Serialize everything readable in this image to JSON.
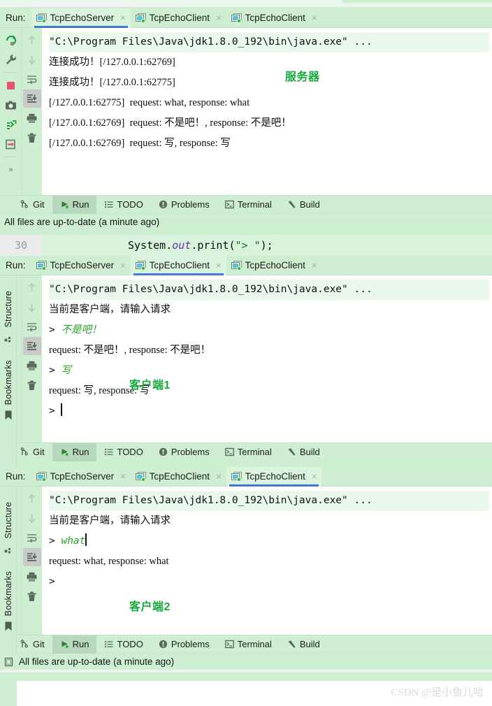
{
  "app": {
    "ide": "IntelliJ IDEA",
    "accent_blue": "#3e7ad1",
    "chrome_green": "#cdeed1",
    "annotation_green": "#15a83a",
    "user_input_green": "#2aa02a"
  },
  "run_label": "Run:",
  "tabs": [
    {
      "label": "TcpEchoServer",
      "close": "×",
      "icon": "run-config-icon"
    },
    {
      "label": "TcpEchoClient",
      "close": "×",
      "icon": "run-config-icon"
    },
    {
      "label": "TcpEchoClient",
      "close": "×",
      "icon": "run-config-icon"
    }
  ],
  "toolbar": {
    "left": [
      {
        "name": "rerun-icon",
        "tooltip": "Rerun"
      },
      {
        "name": "wrench-icon",
        "tooltip": "Edit Configuration"
      },
      {
        "name": "stop-icon",
        "tooltip": "Stop"
      },
      {
        "name": "camera-icon",
        "tooltip": "Dump Threads"
      },
      {
        "name": "threads-icon",
        "tooltip": "Thread Dump"
      },
      {
        "name": "exit-icon",
        "tooltip": "Close Session"
      }
    ],
    "right": [
      {
        "name": "arrow-up-icon",
        "tooltip": "Up the Stack Trace"
      },
      {
        "name": "arrow-down-icon",
        "tooltip": "Down the Stack Trace"
      },
      {
        "name": "soft-wrap-icon",
        "tooltip": "Soft-Wrap"
      },
      {
        "name": "scroll-to-end-icon",
        "tooltip": "Scroll to End",
        "selected": true
      },
      {
        "name": "print-icon",
        "tooltip": "Print"
      },
      {
        "name": "trash-icon",
        "tooltip": "Clear All"
      }
    ],
    "expand": "»"
  },
  "command_line": "\"C:\\Program Files\\Java\\jdk1.8.0_192\\bin\\java.exe\" ...",
  "panels": [
    {
      "id": "server",
      "active_tab_index": 0,
      "annotation": "服务器",
      "lines": [
        {
          "type": "cmd",
          "text": "\"C:\\Program Files\\Java\\jdk1.8.0_192\\bin\\java.exe\" ..."
        },
        {
          "type": "out",
          "text": "连接成功！[/127.0.0.1:62769]"
        },
        {
          "type": "out",
          "text": "连接成功！[/127.0.0.1:62775]"
        },
        {
          "type": "out",
          "text": "[/127.0.0.1:62775]  request: what, response: what"
        },
        {
          "type": "out",
          "text": "[/127.0.0.1:62769]  request: 不是吧！, response: 不是吧！"
        },
        {
          "type": "out",
          "text": "[/127.0.0.1:62769]  request: 写, response: 写"
        }
      ]
    },
    {
      "id": "client1",
      "active_tab_index": 1,
      "annotation": "客户端1",
      "lines": [
        {
          "type": "cmd",
          "text": "\"C:\\Program Files\\Java\\jdk1.8.0_192\\bin\\java.exe\" ..."
        },
        {
          "type": "out",
          "text": "当前是客户端，请输入请求"
        },
        {
          "type": "prompt",
          "prefix": "> ",
          "input": "不是吧！"
        },
        {
          "type": "out",
          "text": "request: 不是吧！, response: 不是吧！"
        },
        {
          "type": "prompt",
          "prefix": "> ",
          "input": "写"
        },
        {
          "type": "out",
          "text": "request: 写, response: 写"
        },
        {
          "type": "prompt",
          "prefix": "> ",
          "input": "",
          "caret": true
        }
      ]
    },
    {
      "id": "client2",
      "active_tab_index": 2,
      "annotation": "客户端2",
      "lines": [
        {
          "type": "cmd",
          "text": "\"C:\\Program Files\\Java\\jdk1.8.0_192\\bin\\java.exe\" ..."
        },
        {
          "type": "out",
          "text": "当前是客户端，请输入请求"
        },
        {
          "type": "prompt",
          "prefix": "> ",
          "input": "what",
          "caret": true
        },
        {
          "type": "out",
          "text": "request: what, response: what"
        },
        {
          "type": "prompt",
          "prefix": "> ",
          "input": ""
        }
      ]
    }
  ],
  "tool_window_bar": {
    "items": [
      {
        "label": "Git",
        "icon": "git-branch-icon"
      },
      {
        "label": "Run",
        "icon": "run-play-icon",
        "active": true
      },
      {
        "label": "TODO",
        "icon": "todo-list-icon"
      },
      {
        "label": "Problems",
        "icon": "problems-warning-icon"
      },
      {
        "label": "Terminal",
        "icon": "terminal-icon"
      },
      {
        "label": "Build",
        "icon": "build-hammer-icon"
      }
    ]
  },
  "status": {
    "message": "All files are up-to-date (a minute ago)",
    "icon": "file-sync-icon"
  },
  "editor": {
    "line_number": "30",
    "code_prefix": "System.",
    "code_italic": "out",
    "code_mid": ".print(",
    "code_string": "\"> \"",
    "code_suffix": ");"
  },
  "left_strip": {
    "structure_label": "Structure",
    "structure_icon": "structure-icon",
    "bookmarks_label": "Bookmarks",
    "bookmarks_icon": "bookmark-icon"
  },
  "watermark": "CSDN @是小鱼儿哈"
}
